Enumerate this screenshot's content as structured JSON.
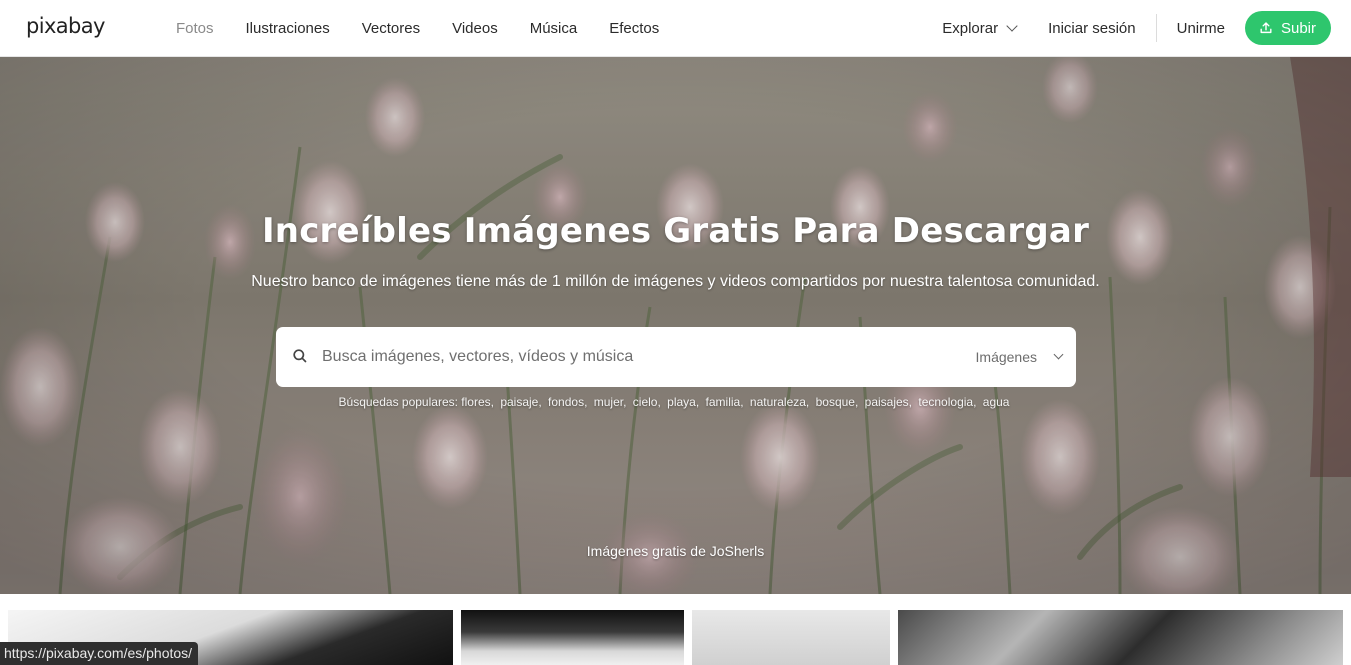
{
  "header": {
    "logo": "pixabay",
    "nav": [
      "Fotos",
      "Ilustraciones",
      "Vectores",
      "Videos",
      "Música",
      "Efectos"
    ],
    "explore": "Explorar",
    "login": "Iniciar sesión",
    "join": "Unirme",
    "upload": "Subir"
  },
  "hero": {
    "title": "Increíbles Imágenes Gratis Para Descargar",
    "subtitle": "Nuestro banco de imágenes tiene más de 1 millón de imágenes y videos compartidos por nuestra talentosa comunidad.",
    "search_placeholder": "Busca imágenes, vectores, vídeos y música",
    "search_type": "Imágenes",
    "popular_label": "Búsquedas populares:",
    "popular_terms": [
      "flores,",
      "paisaje,",
      "fondos,",
      "mujer,",
      "cielo,",
      "playa,",
      "familia,",
      "naturaleza,",
      "bosque,",
      "paisajes,",
      "tecnologia,",
      "agua"
    ],
    "credit": "Imágenes gratis de JoSherls"
  },
  "status_url": "https://pixabay.com/es/photos/",
  "colors": {
    "accent": "#2ec66d",
    "nav_active": "#8a8a8a"
  }
}
